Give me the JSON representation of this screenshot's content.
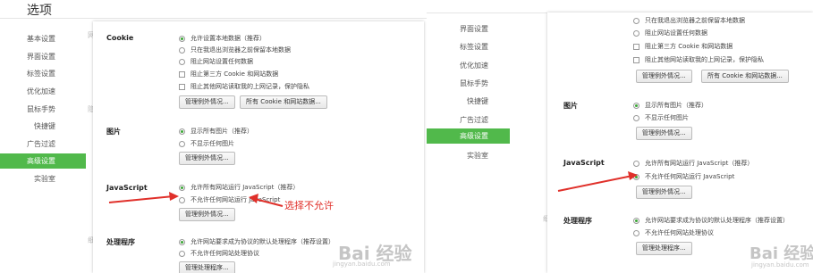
{
  "left": {
    "window_title": "选项",
    "sidebar": [
      {
        "label": "基本设置",
        "active": false
      },
      {
        "label": "界面设置",
        "active": false
      },
      {
        "label": "标签设置",
        "active": false
      },
      {
        "label": "优化加速",
        "active": false
      },
      {
        "label": "鼠标手势",
        "active": false
      },
      {
        "label": "快捷键",
        "active": false
      },
      {
        "label": "广告过滤",
        "active": false
      },
      {
        "label": "高级设置",
        "active": true
      },
      {
        "label": "实验室",
        "active": false
      }
    ],
    "ghost_labels": [
      "网",
      "隐",
      "细"
    ],
    "cookie": {
      "title": "Cookie",
      "radios": [
        "允许设置本地数据（推荐）",
        "只在我退出浏览器之前保留本地数据",
        "阻止网站设置任何数据"
      ],
      "checks": [
        "阻止第三方 Cookie 和网站数据",
        "阻止其他网站读取我的上网记录，保护隐私"
      ],
      "btn_exceptions": "管理例外情况...",
      "btn_all_cookies": "所有 Cookie 和网站数据..."
    },
    "images": {
      "title": "图片",
      "radios": [
        "显示所有图片（推荐）",
        "不显示任何图片"
      ],
      "btn": "管理例外情况..."
    },
    "javascript": {
      "title": "JavaScript",
      "radios": [
        "允许所有网站运行 JavaScript（推荐）",
        "不允许任何网站运行 JavaScript"
      ],
      "btn": "管理例外情况..."
    },
    "handlers": {
      "title": "处理程序",
      "radios": [
        "允许网站要求成为协议的默认处理程序（推荐设置）",
        "不允许任何网站处理协议"
      ],
      "btn": "管理处理程序..."
    },
    "annotation": "选择不允许"
  },
  "right": {
    "sidebar": [
      {
        "label": "界面设置",
        "active": false
      },
      {
        "label": "标签设置",
        "active": false
      },
      {
        "label": "优化加速",
        "active": false
      },
      {
        "label": "鼠标手势",
        "active": false
      },
      {
        "label": "快捷键",
        "active": false
      },
      {
        "label": "广告过滤",
        "active": false
      },
      {
        "label": "高级设置",
        "active": true
      },
      {
        "label": "实验室",
        "active": false
      }
    ],
    "ghost_labels": [
      "细"
    ],
    "cookie": {
      "radios": [
        "只在我退出浏览器之前保留本地数据",
        "阻止网站设置任何数据"
      ],
      "checks": [
        "阻止第三方 Cookie 和网站数据",
        "阻止其他网站读取我的上网记录，保护隐私"
      ],
      "btn_exceptions": "管理例外情况...",
      "btn_all_cookies": "所有 Cookie 和网站数据..."
    },
    "images": {
      "title": "图片",
      "radios": [
        "显示所有图片（推荐）",
        "不显示任何图片"
      ],
      "btn": "管理例外情况..."
    },
    "javascript": {
      "title": "JavaScript",
      "radios": [
        "允许所有网站运行 JavaScript（推荐）",
        "不允许任何网站运行 JavaScript"
      ],
      "btn": "管理例外情况..."
    },
    "handlers": {
      "title": "处理程序",
      "radios": [
        "允许网站要求成为协议的默认处理程序（推荐设置）",
        "不允许任何网站处理协议"
      ],
      "btn": "管理处理程序..."
    }
  },
  "watermark": {
    "logo": "Bai 经验",
    "url": "jingyan.baidu.com"
  },
  "colors": {
    "accent": "#51b94b",
    "annotation": "#e0302a"
  }
}
